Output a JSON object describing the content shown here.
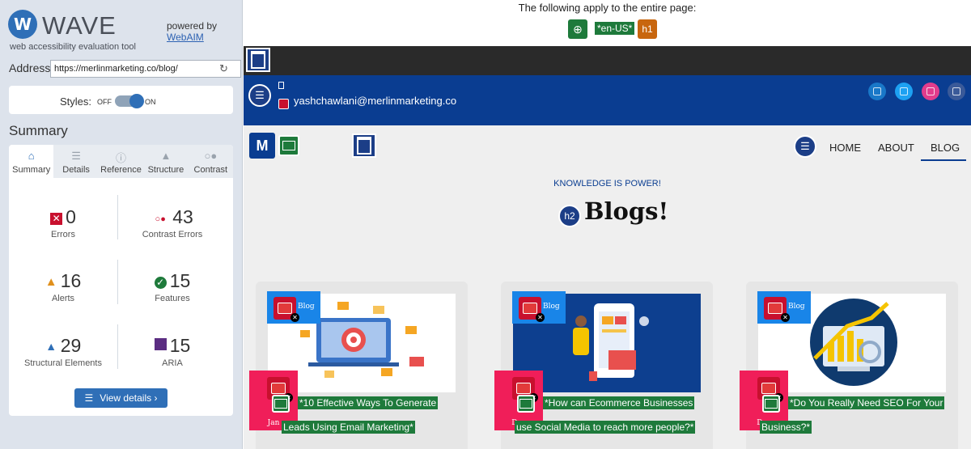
{
  "wave": {
    "name": "WAVE",
    "subtitle": "web accessibility evaluation tool",
    "powered_by": "powered by",
    "powered_link": "WebAIM",
    "address_label": "Address:",
    "address_value": "https://merlinmarketing.co/blog/",
    "styles_label": "Styles:",
    "styles_off": "OFF",
    "styles_on": "ON",
    "summary_title": "Summary",
    "tabs": [
      {
        "label": "Summary",
        "icon": "home-icon"
      },
      {
        "label": "Details",
        "icon": "list-icon"
      },
      {
        "label": "Reference",
        "icon": "info-icon"
      },
      {
        "label": "Structure",
        "icon": "structure-icon"
      },
      {
        "label": "Contrast",
        "icon": "contrast-icon"
      }
    ],
    "stats": {
      "errors": {
        "value": "0",
        "label": "Errors"
      },
      "contrast": {
        "value": "43",
        "label": "Contrast Errors"
      },
      "alerts": {
        "value": "16",
        "label": "Alerts"
      },
      "features": {
        "value": "15",
        "label": "Features"
      },
      "structural": {
        "value": "29",
        "label": "Structural Elements"
      },
      "aria": {
        "value": "15",
        "label": "ARIA"
      }
    },
    "view_details": "View details ›"
  },
  "page": {
    "apply_text": "The following apply to the entire page:",
    "lang_tag": "*en-US*",
    "h1_tag": "h1",
    "h2_tag": "h2",
    "email": "yashchawlani@merlinmarketing.co",
    "nav": {
      "home": "HOME",
      "about": "ABOUT",
      "blog": "BLOG"
    },
    "kicker": "KNOWLEDGE IS POWER!",
    "title": "Blogs!",
    "cards": [
      {
        "category": "Blog",
        "month": "Jan",
        "line1": "*10 Effective Ways To Generate",
        "line2": "Leads Using Email Marketing*"
      },
      {
        "category": "Blog",
        "month": "Dec",
        "line1": "*How can Ecommerce Businesses",
        "line2": "use Social Media to reach more people?*"
      },
      {
        "category": "Blog",
        "month": "Dec",
        "line1": "*Do You Really Need SEO For Your",
        "line2": "Business?*"
      }
    ]
  },
  "colors": {
    "wave_blue": "#2f6fb7",
    "site_blue": "#0a3d91",
    "error_red": "#c8102e",
    "date_pink": "#f01e59",
    "category_blue": "#1985e8",
    "feature_green": "#1e7a3b",
    "aria_purple": "#5b2d82"
  }
}
